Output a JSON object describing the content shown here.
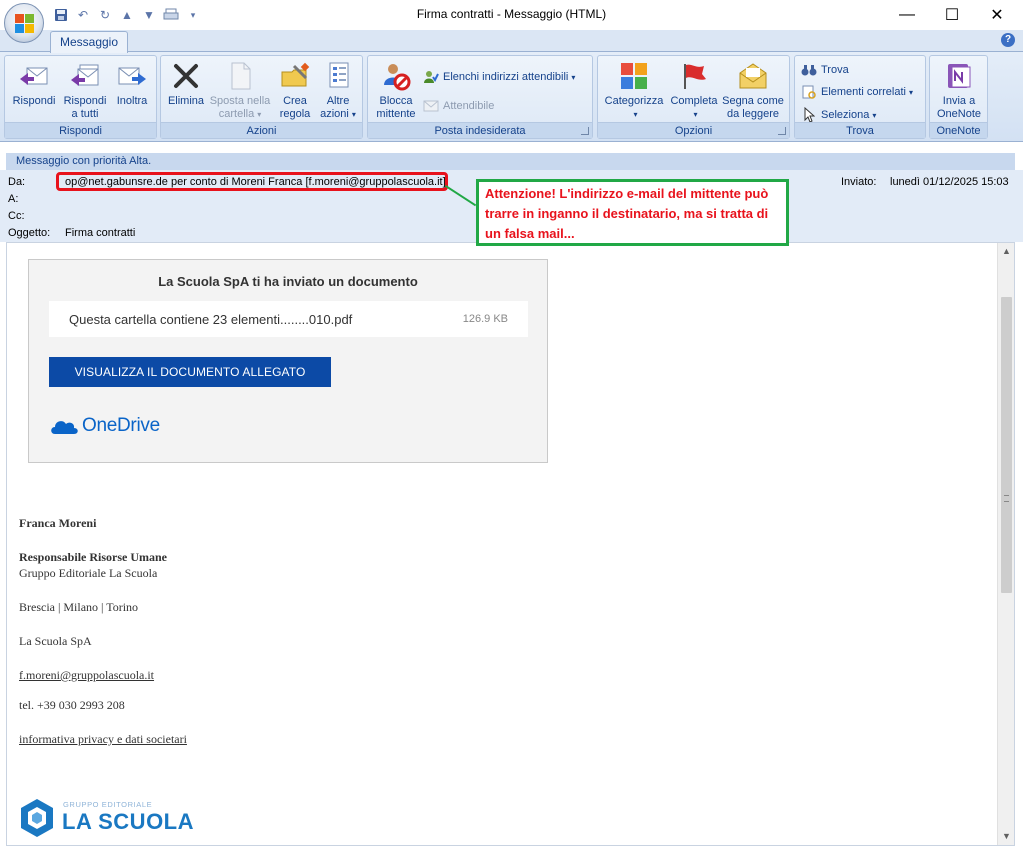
{
  "window": {
    "title": "Firma contratti - Messaggio (HTML)",
    "minimize": "—",
    "maximize": "☐",
    "close": "✕"
  },
  "ribbon": {
    "tabs": [
      "Messaggio"
    ],
    "help": "?",
    "groups": {
      "rispondi": {
        "label": "Rispondi",
        "reply": "Rispondi",
        "reply_all_1": "Rispondi",
        "reply_all_2": "a tutti",
        "forward": "Inoltra"
      },
      "azioni": {
        "label": "Azioni",
        "delete": "Elimina",
        "move_1": "Sposta nella",
        "move_2": "cartella",
        "rule_1": "Crea",
        "rule_2": "regola",
        "other_1": "Altre",
        "other_2": "azioni"
      },
      "posta": {
        "label": "Posta indesiderata",
        "block_1": "Blocca",
        "block_2": "mittente",
        "safe_lists": "Elenchi indirizzi attendibili",
        "safe": "Attendibile"
      },
      "opzioni": {
        "label": "Opzioni",
        "categorize": "Categorizza",
        "followup": "Completa",
        "unread_1": "Segna come",
        "unread_2": "da leggere"
      },
      "trova": {
        "label": "Trova",
        "find": "Trova",
        "related": "Elementi correlati",
        "select": "Seleziona"
      },
      "onenote": {
        "label": "OneNote",
        "send_1": "Invia a",
        "send_2": "OneNote"
      }
    }
  },
  "message": {
    "priority": "Messaggio con priorità Alta.",
    "from_label": "Da:",
    "from": "op@net.gabunsre.de per conto di Moreni Franca [f.moreni@gruppolascuola.it]",
    "to_label": "A:",
    "cc_label": "Cc:",
    "subject_label": "Oggetto:",
    "subject": "Firma contratti",
    "sent_label": "Inviato:",
    "sent": "lunedì 01/12/2025 15:03"
  },
  "warning": {
    "text": "Attenzione! L'indirizzo e-mail del mittente può trarre in inganno il destinatario, ma si tratta di un falsa mail...",
    "border_color": "#21a846",
    "text_color": "#e8121c"
  },
  "card": {
    "title": "La Scuola SpA ti ha inviato un documento",
    "file_name": "Questa cartella contiene 23 elementi........010.pdf",
    "file_size": "126.9 KB",
    "button": "VISUALIZZA IL DOCUMENTO ALLEGATO",
    "brand": "OneDrive",
    "button_color": "#0c4aa6"
  },
  "signature": {
    "name": "Franca Moreni",
    "role": "Responsabile Risorse Umane",
    "company": "Gruppo Editoriale La Scuola",
    "cities": "Brescia | Milano | Torino",
    "spa": "La Scuola SpA",
    "email": "f.moreni@gruppolascuola.it",
    "phone": "tel. +39 030 2993 208",
    "privacy": "informativa privacy e dati societari",
    "logo_small": "GRUPPO EDITORIALE",
    "logo_big": "LA SCUOLA"
  }
}
